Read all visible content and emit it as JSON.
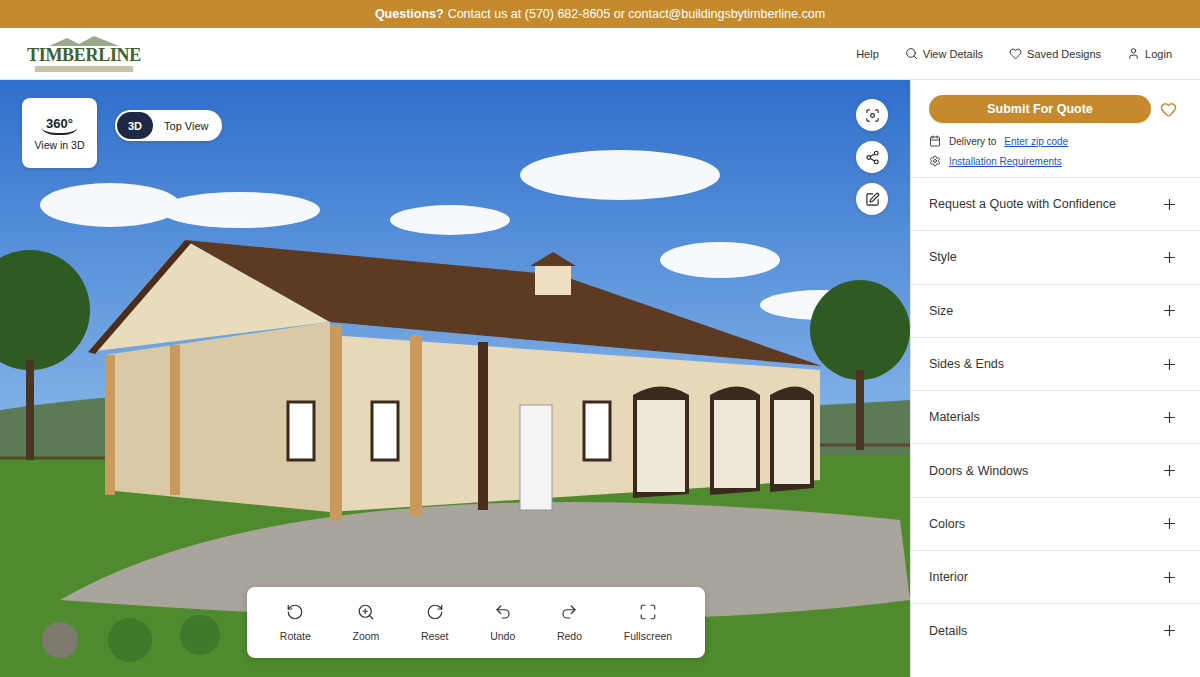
{
  "banner": {
    "lead": "Questions?",
    "text": "Contact us at (570) 682-8605 or contact@buildingsbytimberline.com"
  },
  "logo": {
    "text": "TIMBERLINE"
  },
  "nav": [
    {
      "label": "Help"
    },
    {
      "label": "View Details"
    },
    {
      "label": "Saved Designs"
    },
    {
      "label": "Login"
    }
  ],
  "viewer": {
    "badge": "360°",
    "label": "View in 3D",
    "modes": [
      {
        "label": "3D",
        "selected": true
      },
      {
        "label": "Top View",
        "selected": false
      }
    ],
    "tools": [
      "Rotate",
      "Zoom",
      "Reset",
      "Undo",
      "Redo",
      "Fullscreen"
    ]
  },
  "sidebar": {
    "submit": "Submit For Quote",
    "delivery": {
      "prefix": "Delivery to",
      "link": "Enter zip code"
    },
    "installation": "Installation Requirements",
    "sections": [
      {
        "label": "Request a Quote with Confidence",
        "expanded": false
      },
      {
        "label": "Style",
        "expanded": false
      },
      {
        "label": "Size",
        "expanded": false
      },
      {
        "label": "Sides & Ends",
        "expanded": false
      },
      {
        "label": "Materials",
        "expanded": false
      },
      {
        "label": "Doors & Windows",
        "expanded": false
      },
      {
        "label": "Colors",
        "expanded": false
      },
      {
        "label": "Interior",
        "expanded": false
      },
      {
        "label": "Details",
        "expanded": false
      }
    ]
  }
}
